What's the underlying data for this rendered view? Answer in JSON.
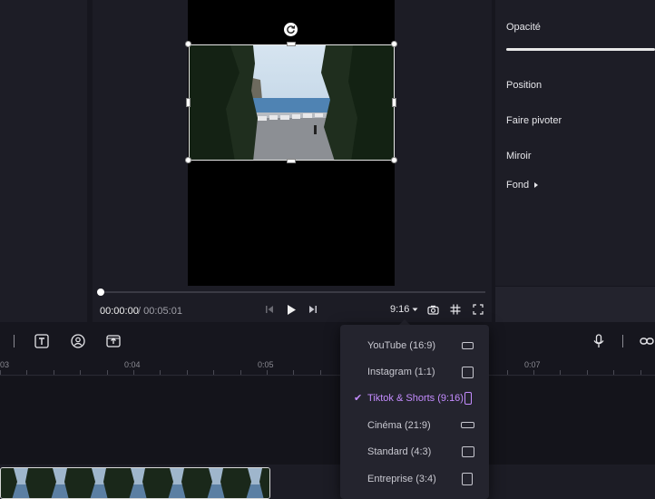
{
  "properties": {
    "opacity_label": "Opacité",
    "position_label": "Position",
    "rotate_label": "Faire pivoter",
    "mirror_label": "Miroir",
    "background_label": "Fond"
  },
  "player": {
    "current_time": "00:00:00",
    "total_time": "/ 00:05:01",
    "aspect_ratio": "9:16"
  },
  "ruler": {
    "ticks": [
      "03",
      "0:04",
      "0:05",
      "0:07"
    ]
  },
  "aspect_menu": {
    "items": [
      {
        "label": "YouTube (16:9)",
        "selected": false
      },
      {
        "label": "Instagram (1:1)",
        "selected": false
      },
      {
        "label": "Tiktok & Shorts (9:16)",
        "selected": true
      },
      {
        "label": "Cinéma (21:9)",
        "selected": false
      },
      {
        "label": "Standard (4:3)",
        "selected": false
      },
      {
        "label": "Entreprise (3:4)",
        "selected": false
      }
    ]
  },
  "colors": {
    "accent": "#c48cff",
    "panel": "#1d1d26",
    "background": "#16161e"
  }
}
